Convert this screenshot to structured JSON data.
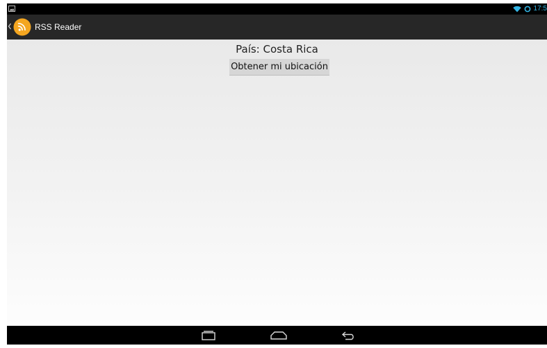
{
  "status_bar": {
    "time": "17:5",
    "icons": [
      "image-notification-icon",
      "wifi-icon",
      "sync-icon"
    ],
    "accent_color": "#33b5e5"
  },
  "action_bar": {
    "title": "RSS Reader",
    "icons": [
      "up-caret-icon",
      "rss-app-icon"
    ],
    "icon_color": "#f4a620",
    "background": "#272727"
  },
  "main": {
    "country_label": "País: Costa Rica",
    "location_button_label": "Obtener mi ubicación"
  },
  "nav_bar": {
    "icons": [
      "recents-icon",
      "home-icon",
      "back-icon"
    ]
  }
}
